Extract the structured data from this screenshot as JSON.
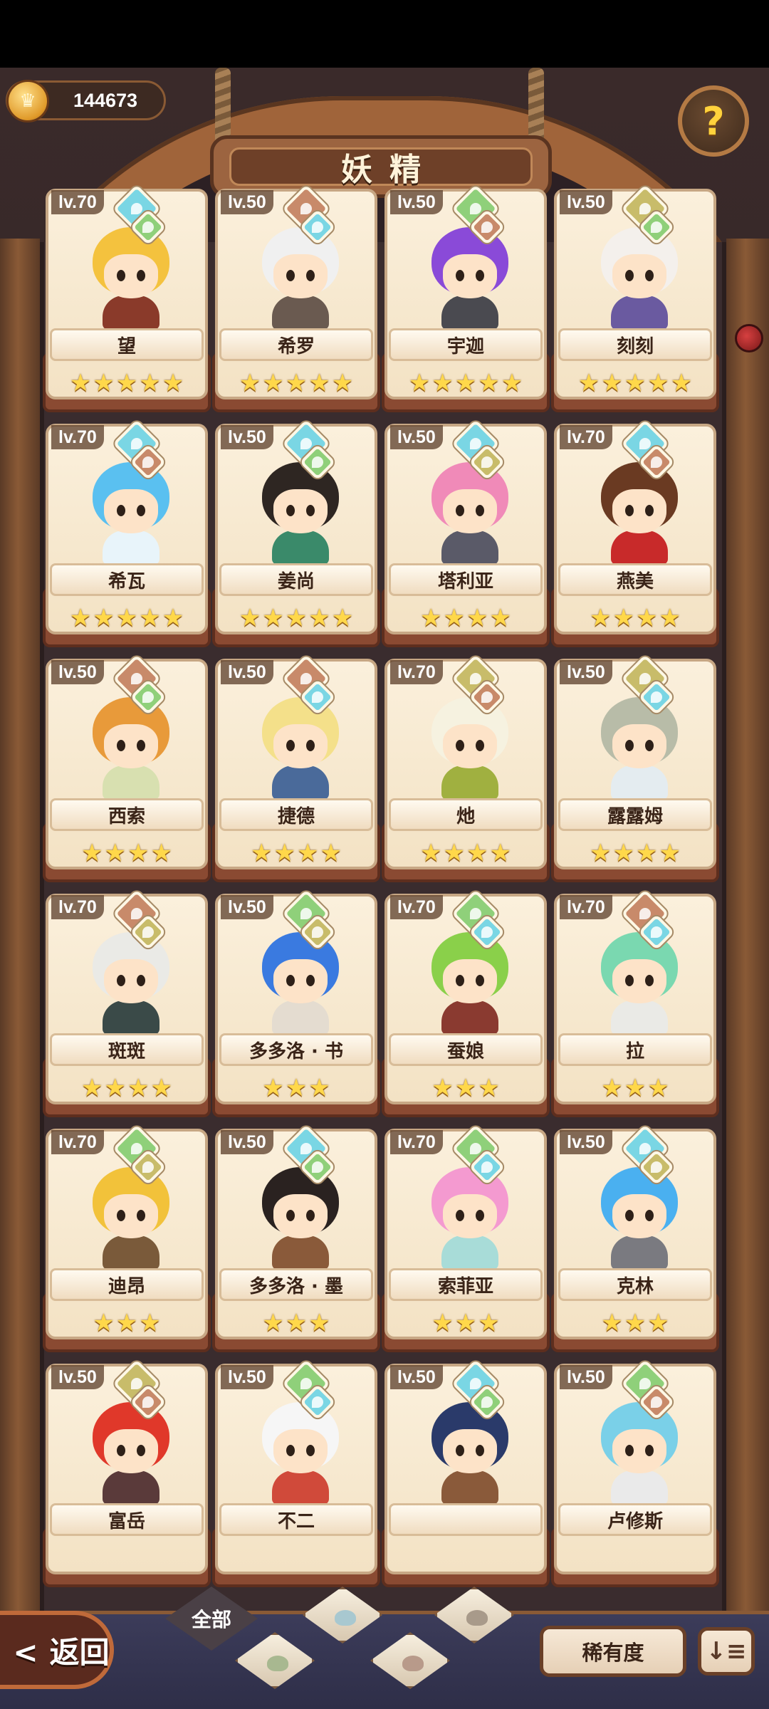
{
  "currency": {
    "amount": "144673",
    "icon": "crown-coin-icon"
  },
  "header": {
    "title": "妖精",
    "help_icon": "question-mark-icon",
    "help_symbol": "?"
  },
  "cards": [
    {
      "name": "望",
      "level": "lv.70",
      "stars": 5,
      "gems": [
        "water",
        "leaf"
      ],
      "hair": "#f4c23e",
      "outfit": "#8a3a2a"
    },
    {
      "name": "希罗",
      "level": "lv.50",
      "stars": 5,
      "gems": [
        "earth",
        "water"
      ],
      "hair": "#f0f0f0",
      "outfit": "#6a5a50"
    },
    {
      "name": "宇迦",
      "level": "lv.50",
      "stars": 5,
      "gems": [
        "leaf",
        "earth"
      ],
      "hair": "#8a4ad8",
      "outfit": "#4a4a50"
    },
    {
      "name": "刻刻",
      "level": "lv.50",
      "stars": 5,
      "gems": [
        "sand",
        "leaf"
      ],
      "hair": "#f4f0ec",
      "outfit": "#6a5aa0"
    },
    {
      "name": "希瓦",
      "level": "lv.70",
      "stars": 5,
      "gems": [
        "water",
        "earth"
      ],
      "hair": "#5ac0f0",
      "outfit": "#e8f4fa"
    },
    {
      "name": "姜尚",
      "level": "lv.50",
      "stars": 5,
      "gems": [
        "water",
        "leaf"
      ],
      "hair": "#2e2622",
      "outfit": "#3a8a6a"
    },
    {
      "name": "塔利亚",
      "level": "lv.50",
      "stars": 4,
      "gems": [
        "water",
        "sand"
      ],
      "hair": "#f08ab8",
      "outfit": "#5a5a68"
    },
    {
      "name": "燕美",
      "level": "lv.70",
      "stars": 4,
      "gems": [
        "water",
        "earth"
      ],
      "hair": "#6a3a22",
      "outfit": "#c82a2a"
    },
    {
      "name": "西索",
      "level": "lv.50",
      "stars": 4,
      "gems": [
        "earth",
        "leaf"
      ],
      "hair": "#e89a3a",
      "outfit": "#d8e0b0"
    },
    {
      "name": "捷德",
      "level": "lv.50",
      "stars": 4,
      "gems": [
        "earth",
        "water"
      ],
      "hair": "#f4e08a",
      "outfit": "#4a6a9a"
    },
    {
      "name": "灺",
      "level": "lv.70",
      "stars": 4,
      "gems": [
        "sand",
        "earth"
      ],
      "hair": "#f6f2e0",
      "outfit": "#a0b040"
    },
    {
      "name": "露露姆",
      "level": "lv.50",
      "stars": 4,
      "gems": [
        "sand",
        "water"
      ],
      "hair": "#b8bca8",
      "outfit": "#e4ecf0"
    },
    {
      "name": "斑斑",
      "level": "lv.70",
      "stars": 4,
      "gems": [
        "earth",
        "sand"
      ],
      "hair": "#eaeae6",
      "outfit": "#3a4a48"
    },
    {
      "name": "多多洛 · 书",
      "level": "lv.50",
      "stars": 3,
      "gems": [
        "leaf",
        "sand"
      ],
      "hair": "#3a7ae0",
      "outfit": "#e4dcd0"
    },
    {
      "name": "蚕娘",
      "level": "lv.70",
      "stars": 3,
      "gems": [
        "leaf",
        "water"
      ],
      "hair": "#8ad04a",
      "outfit": "#8a3a30"
    },
    {
      "name": "拉",
      "level": "lv.70",
      "stars": 3,
      "gems": [
        "earth",
        "water"
      ],
      "hair": "#7ad8b0",
      "outfit": "#eaeae6"
    },
    {
      "name": "迪昂",
      "level": "lv.70",
      "stars": 3,
      "gems": [
        "leaf",
        "sand"
      ],
      "hair": "#f2c23a",
      "outfit": "#7a5a3a"
    },
    {
      "name": "多多洛 · 墨",
      "level": "lv.50",
      "stars": 3,
      "gems": [
        "water",
        "leaf"
      ],
      "hair": "#2a2220",
      "outfit": "#8a5a3a"
    },
    {
      "name": "索菲亚",
      "level": "lv.70",
      "stars": 3,
      "gems": [
        "leaf",
        "water"
      ],
      "hair": "#f49ad0",
      "outfit": "#a8dcd8"
    },
    {
      "name": "克林",
      "level": "lv.50",
      "stars": 3,
      "gems": [
        "water",
        "sand"
      ],
      "hair": "#4ab0f0",
      "outfit": "#7a7a80"
    },
    {
      "name": "富岳",
      "level": "lv.50",
      "stars": 0,
      "gems": [
        "sand",
        "earth"
      ],
      "hair": "#e0382a",
      "outfit": "#5a3a3a"
    },
    {
      "name": "不二",
      "level": "lv.50",
      "stars": 0,
      "gems": [
        "leaf",
        "water"
      ],
      "hair": "#f6f6f6",
      "outfit": "#d04a3a"
    },
    {
      "name": "",
      "level": "lv.50",
      "stars": 0,
      "gems": [
        "water",
        "leaf"
      ],
      "hair": "#2a3a6a",
      "outfit": "#8a5a3a"
    },
    {
      "name": "卢修斯",
      "level": "lv.50",
      "stars": 0,
      "gems": [
        "leaf",
        "earth"
      ],
      "hair": "#7ad0e8",
      "outfit": "#eaeaea"
    }
  ],
  "gem_colors": {
    "water": "#7ad6e4",
    "leaf": "#8fd07a",
    "earth": "#c88a6a",
    "sand": "#c8bc6a"
  },
  "bottom": {
    "back_label": "返回",
    "back_arrow": "<",
    "filter_all_label": "全部",
    "filters": [
      {
        "name": "leaf-filter-icon",
        "color": "#a8b890"
      },
      {
        "name": "water-filter-icon",
        "color": "#a8c8d0"
      },
      {
        "name": "earth-filter-icon",
        "color": "#b89a8a"
      },
      {
        "name": "mountain-filter-icon",
        "color": "#a89a8a"
      }
    ],
    "rarity_label": "稀有度",
    "sort_icon": "sort-list-icon",
    "sort_symbol": "↓≡"
  }
}
